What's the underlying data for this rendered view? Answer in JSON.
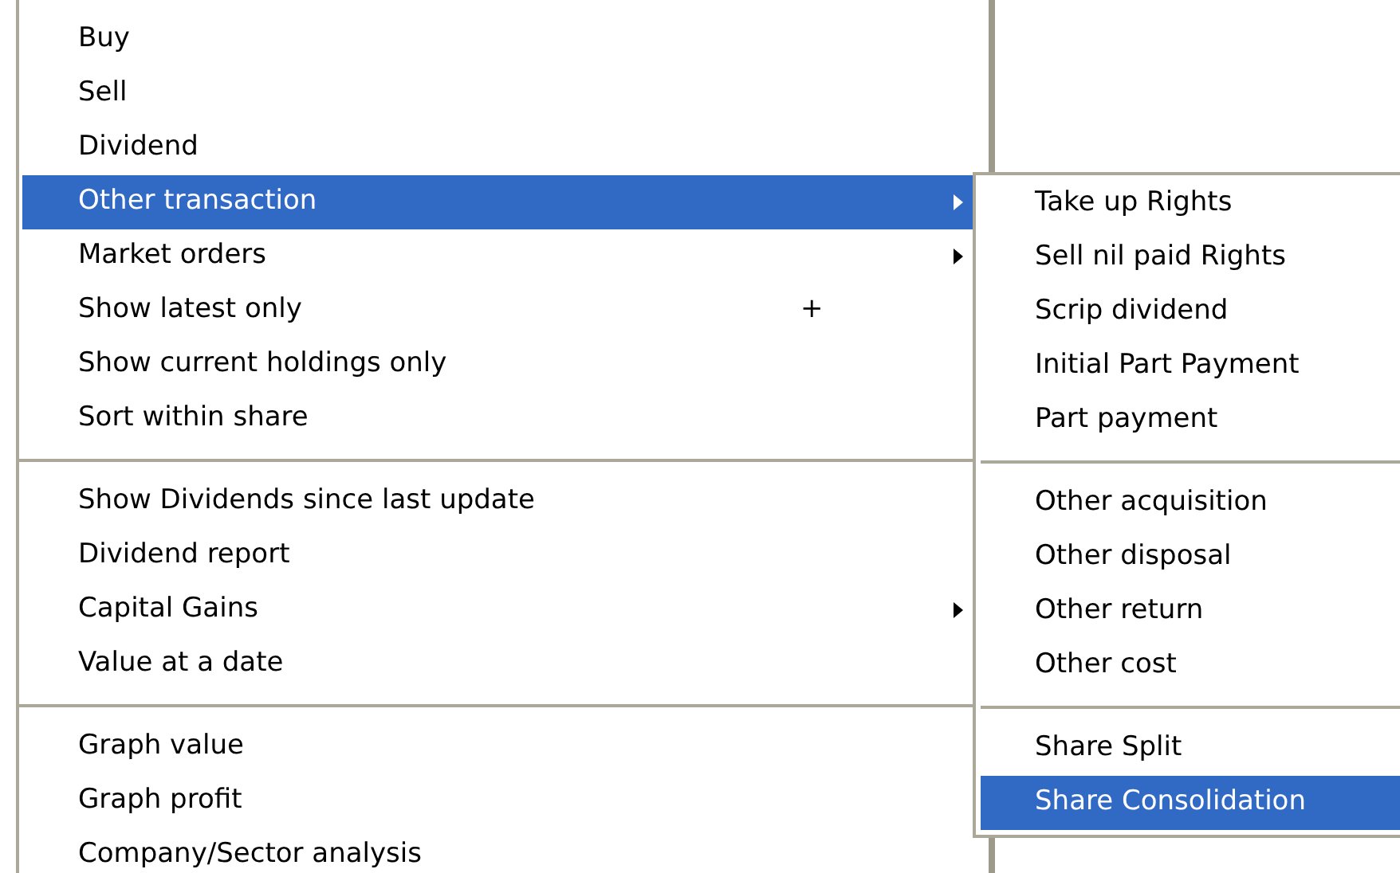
{
  "menu": {
    "items": [
      {
        "kind": "item",
        "label": "Buy",
        "selected": false,
        "submenu": false
      },
      {
        "kind": "item",
        "label": "Sell",
        "selected": false,
        "submenu": false
      },
      {
        "kind": "item",
        "label": "Dividend",
        "selected": false,
        "submenu": false
      },
      {
        "kind": "item",
        "label": "Other transaction",
        "selected": true,
        "submenu": true
      },
      {
        "kind": "item",
        "label": "Market orders",
        "selected": false,
        "submenu": true
      },
      {
        "kind": "item",
        "label": "Show latest only",
        "selected": false,
        "submenu": false,
        "shortcut": "+"
      },
      {
        "kind": "item",
        "label": "Show current holdings only",
        "selected": false,
        "submenu": false
      },
      {
        "kind": "item",
        "label": "Sort within share",
        "selected": false,
        "submenu": false
      },
      {
        "kind": "separator"
      },
      {
        "kind": "item",
        "label": "Show Dividends since last update",
        "selected": false,
        "submenu": false
      },
      {
        "kind": "item",
        "label": "Dividend report",
        "selected": false,
        "submenu": false
      },
      {
        "kind": "item",
        "label": "Capital Gains",
        "selected": false,
        "submenu": true
      },
      {
        "kind": "item",
        "label": "Value at a date",
        "selected": false,
        "submenu": false
      },
      {
        "kind": "separator"
      },
      {
        "kind": "item",
        "label": "Graph value",
        "selected": false,
        "submenu": false
      },
      {
        "kind": "item",
        "label": "Graph profit",
        "selected": false,
        "submenu": false
      },
      {
        "kind": "item",
        "label": "Company/Sector analysis",
        "selected": false,
        "submenu": false
      }
    ]
  },
  "submenu": {
    "items": [
      {
        "kind": "item",
        "label": "Take up Rights",
        "selected": false
      },
      {
        "kind": "item",
        "label": "Sell nil paid Rights",
        "selected": false
      },
      {
        "kind": "item",
        "label": "Scrip dividend",
        "selected": false
      },
      {
        "kind": "item",
        "label": "Initial Part Payment",
        "selected": false
      },
      {
        "kind": "item",
        "label": "Part payment",
        "selected": false
      },
      {
        "kind": "separator"
      },
      {
        "kind": "item",
        "label": "Other acquisition",
        "selected": false
      },
      {
        "kind": "item",
        "label": "Other disposal",
        "selected": false
      },
      {
        "kind": "item",
        "label": "Other return",
        "selected": false
      },
      {
        "kind": "item",
        "label": "Other cost",
        "selected": false
      },
      {
        "kind": "separator"
      },
      {
        "kind": "item",
        "label": "Share Split",
        "selected": false
      },
      {
        "kind": "item",
        "label": "Share Consolidation",
        "selected": true
      }
    ]
  }
}
